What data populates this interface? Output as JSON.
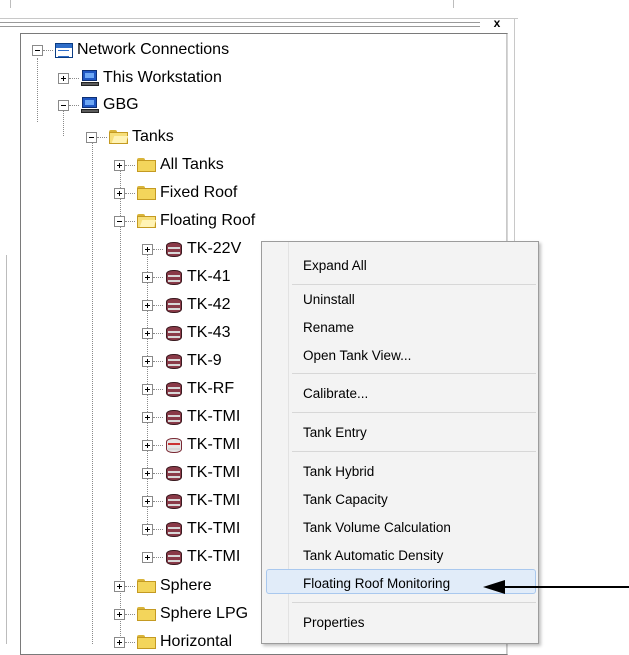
{
  "window": {
    "close_symbol": "x"
  },
  "tree": {
    "items": [
      {
        "label": "Network Connections",
        "icon": "network-connections-icon",
        "expander": "minus"
      },
      {
        "label": "This Workstation",
        "icon": "computer-icon",
        "expander": "plus"
      },
      {
        "label": "GBG",
        "icon": "computer-icon",
        "expander": "minus"
      },
      {
        "label": "Tanks",
        "icon": "open-folder-icon",
        "expander": "minus"
      },
      {
        "label": "All Tanks",
        "icon": "folder-icon",
        "expander": "plus"
      },
      {
        "label": "Fixed Roof",
        "icon": "folder-icon",
        "expander": "plus"
      },
      {
        "label": "Floating Roof",
        "icon": "open-folder-icon",
        "expander": "minus"
      },
      {
        "label": "TK-22V",
        "icon": "tank-icon",
        "expander": "plus"
      },
      {
        "label": "TK-41",
        "icon": "tank-icon",
        "expander": "plus"
      },
      {
        "label": "TK-42",
        "icon": "tank-icon",
        "expander": "plus"
      },
      {
        "label": "TK-43",
        "icon": "tank-icon",
        "expander": "plus"
      },
      {
        "label": "TK-9",
        "icon": "tank-icon",
        "expander": "plus"
      },
      {
        "label": "TK-RF",
        "icon": "tank-icon",
        "expander": "plus"
      },
      {
        "label": "TK-TMI",
        "icon": "tank-icon",
        "expander": "plus"
      },
      {
        "label": "TK-TMI",
        "icon": "tank-alarm-icon",
        "expander": "plus"
      },
      {
        "label": "TK-TMI",
        "icon": "tank-icon",
        "expander": "plus"
      },
      {
        "label": "TK-TMI",
        "icon": "tank-icon",
        "expander": "plus"
      },
      {
        "label": "TK-TMI",
        "icon": "tank-icon",
        "expander": "plus"
      },
      {
        "label": "TK-TMI",
        "icon": "tank-icon",
        "expander": "plus"
      },
      {
        "label": "Sphere",
        "icon": "folder-icon",
        "expander": "plus"
      },
      {
        "label": "Sphere LPG",
        "icon": "folder-icon",
        "expander": "plus"
      },
      {
        "label": "Horizontal",
        "icon": "folder-icon",
        "expander": "plus"
      }
    ]
  },
  "context_menu": {
    "items": [
      {
        "label": "Expand All"
      },
      {
        "label": "Uninstall"
      },
      {
        "label": "Rename"
      },
      {
        "label": "Open Tank View..."
      },
      {
        "label": "Calibrate..."
      },
      {
        "label": "Tank Entry"
      },
      {
        "label": "Tank Hybrid"
      },
      {
        "label": "Tank Capacity"
      },
      {
        "label": "Tank Volume Calculation"
      },
      {
        "label": "Tank Automatic Density"
      },
      {
        "label": "Floating Roof Monitoring",
        "highlighted": true
      },
      {
        "label": "Properties"
      }
    ]
  },
  "colors": {
    "menu_background": "#f3f3f3",
    "menu_highlight": "#e1ecf9",
    "tank_body": "#8a3a48",
    "folder": "#f3d55b"
  }
}
